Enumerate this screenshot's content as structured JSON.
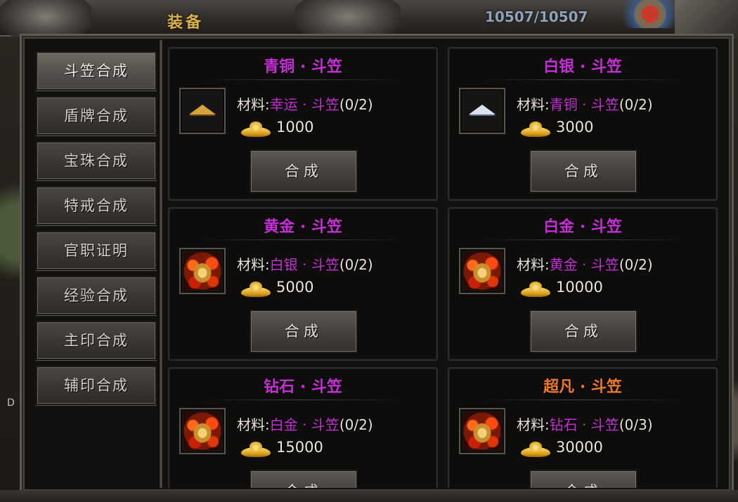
{
  "window": {
    "title": "装备",
    "hp": "10507/10507"
  },
  "sidebar": {
    "items": [
      {
        "label": "斗笠合成",
        "active": true
      },
      {
        "label": "盾牌合成"
      },
      {
        "label": "宝珠合成"
      },
      {
        "label": "特戒合成"
      },
      {
        "label": "官职证明"
      },
      {
        "label": "经验合成"
      },
      {
        "label": "主印合成"
      },
      {
        "label": "辅印合成"
      }
    ]
  },
  "edge_letter": "D",
  "colors": {
    "purple": "#c82fd8",
    "orange": "#f07a24",
    "gold": "#d8b24a"
  },
  "cards": [
    {
      "title": "青铜 · 斗笠",
      "title_color": "purple",
      "icon": "bronze-hat-icon",
      "mat_prefix": "材料:",
      "mat_item": "幸运 · 斗笠",
      "mat_count": "(0/2)",
      "cost": "1000",
      "button": "合成"
    },
    {
      "title": "白银 · 斗笠",
      "title_color": "purple",
      "icon": "silver-hat-icon",
      "mat_prefix": "材料:",
      "mat_item": "青铜 · 斗笠",
      "mat_count": "(0/2)",
      "cost": "3000",
      "button": "合成"
    },
    {
      "title": "黄金 · 斗笠",
      "title_color": "purple",
      "icon": "gold-hat-icon",
      "mat_prefix": "材料:",
      "mat_item": "白银 · 斗笠",
      "mat_count": "(0/2)",
      "cost": "5000",
      "button": "合成"
    },
    {
      "title": "白金 · 斗笠",
      "title_color": "purple",
      "icon": "platinum-hat-icon",
      "mat_prefix": "材料:",
      "mat_item": "黄金 · 斗笠",
      "mat_count": "(0/2)",
      "cost": "10000",
      "button": "合成"
    },
    {
      "title": "钻石 · 斗笠",
      "title_color": "purple",
      "icon": "diamond-hat-icon",
      "mat_prefix": "材料:",
      "mat_item": "白金 · 斗笠",
      "mat_count": "(0/2)",
      "cost": "15000",
      "button": "合成"
    },
    {
      "title": "超凡 · 斗笠",
      "title_color": "orange",
      "icon": "transcendent-hat-icon",
      "mat_prefix": "材料:",
      "mat_item": "钻石 · 斗笠",
      "mat_count": "(0/3)",
      "cost": "30000",
      "button": "合成"
    }
  ]
}
